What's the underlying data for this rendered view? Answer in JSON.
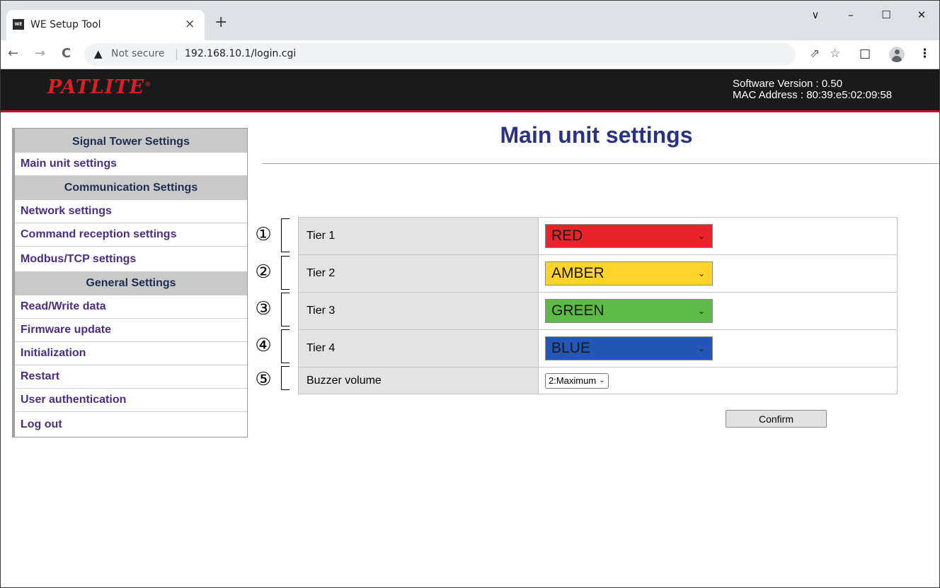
{
  "browser": {
    "tab_title": "WE Setup Tool",
    "favicon_text": "WE",
    "close_glyph": "×",
    "new_tab_glyph": "+",
    "window_controls": [
      "∨",
      "–",
      "☐",
      "✕"
    ],
    "back_glyph": "←",
    "forward_glyph": "→",
    "reload_glyph": "C",
    "security_glyph": "▲",
    "security_label": "Not secure",
    "url": "192.168.10.1/login.cgi",
    "share_glyph": "⇗",
    "star_glyph": "☆",
    "panel_glyph": "□",
    "menu_glyph": "⋮"
  },
  "header": {
    "logo": "PATLITE",
    "logo_mark": "®",
    "software_version": "Software Version : 0.50",
    "mac_address": "MAC Address : 80:39:e5:02:09:58"
  },
  "sidebar": {
    "sections": [
      {
        "heading": "Signal Tower Settings",
        "items": [
          "Main unit settings"
        ]
      },
      {
        "heading": "Communication Settings",
        "items": [
          "Network settings",
          "Command reception settings",
          "Modbus/TCP settings"
        ]
      },
      {
        "heading": "General Settings",
        "items": [
          "Read/Write data",
          "Firmware update",
          "Initialization",
          "Restart",
          "User authentication",
          "Log out"
        ]
      }
    ]
  },
  "main": {
    "title": "Main unit settings",
    "markers": [
      "①",
      "②",
      "③",
      "④",
      "⑤"
    ],
    "rows": [
      {
        "label": "Tier 1",
        "value": "RED",
        "bg": "#e8242a",
        "fg": "#1a1a1a"
      },
      {
        "label": "Tier 2",
        "value": "AMBER",
        "bg": "#ffd42a",
        "fg": "#1a1a1a"
      },
      {
        "label": "Tier 3",
        "value": "GREEN",
        "bg": "#5cb946",
        "fg": "#1a1a1a"
      },
      {
        "label": "Tier 4",
        "value": "BLUE",
        "bg": "#2456b5",
        "fg": "#1a1a1a"
      }
    ],
    "buzzer": {
      "label": "Buzzer volume",
      "value": "2:Maximum"
    },
    "dropdown_glyph": "⌄",
    "confirm_label": "Confirm"
  }
}
